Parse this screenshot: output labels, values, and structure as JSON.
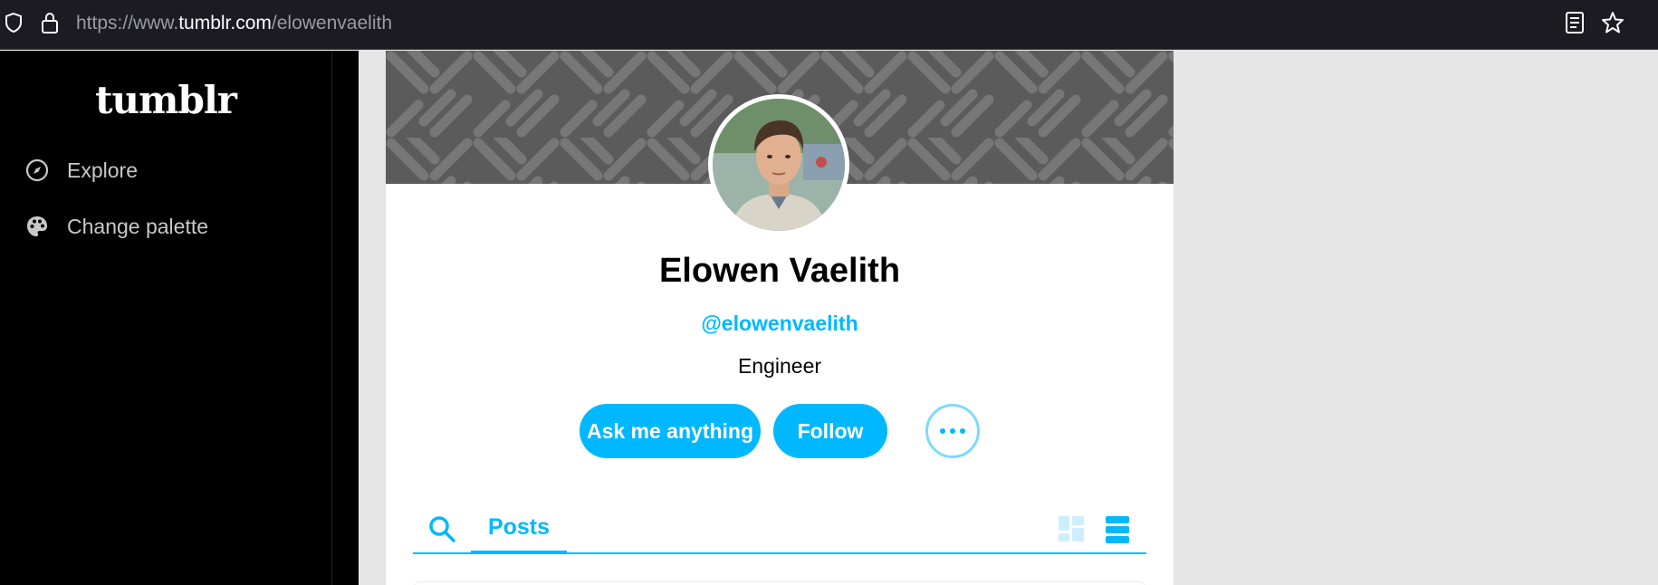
{
  "browser": {
    "url_prefix": "https://www.",
    "url_domain": "tumblr.com",
    "url_path": "/elowenvaelith"
  },
  "sidebar": {
    "logo": "tumblr",
    "items": [
      {
        "label": "Explore",
        "icon": "compass-icon"
      },
      {
        "label": "Change palette",
        "icon": "palette-icon"
      }
    ]
  },
  "profile": {
    "title": "Elowen Vaelith",
    "url": "@elowenvaelith",
    "description": "Engineer",
    "ask_label": "Ask me anything",
    "follow_label": "Follow"
  },
  "tabs": {
    "posts_label": "Posts"
  },
  "colors": {
    "accent": "#00b8ff",
    "header": "#5b5b5b",
    "sidebar": "#000000"
  }
}
